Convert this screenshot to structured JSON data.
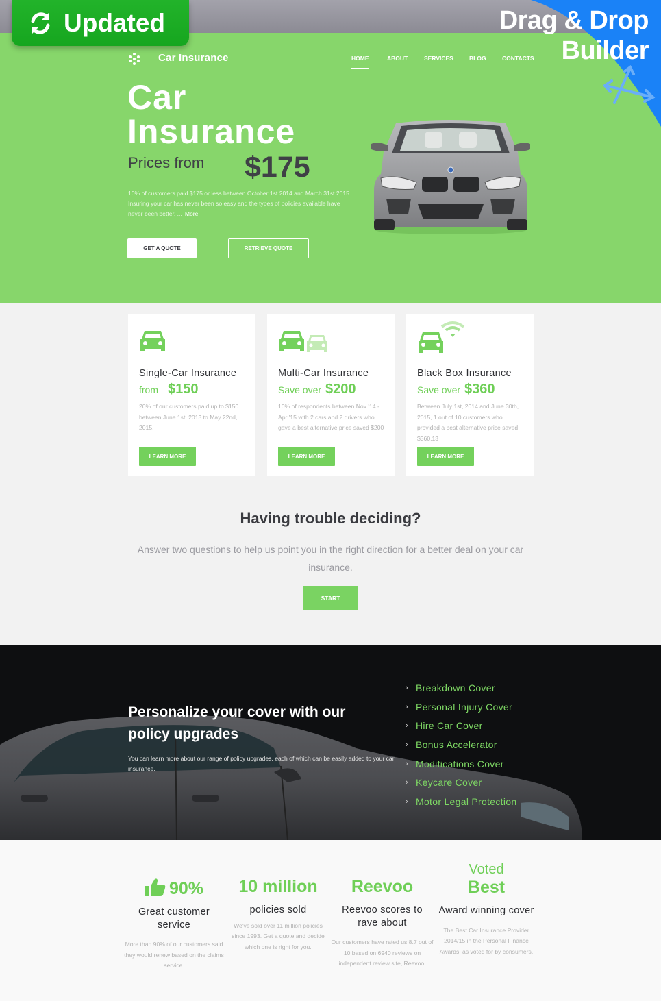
{
  "badges": {
    "updated_label": "Updated",
    "drag_drop_line1": "Drag & Drop",
    "drag_drop_line2": "Builder",
    "updated_color": "#1db025",
    "drag_drop_color": "#1a82f7"
  },
  "header": {
    "brand": "Car Insurance",
    "logo_icon": "dots-logo-icon",
    "nav": [
      {
        "label": "HOME",
        "active": true
      },
      {
        "label": "ABOUT",
        "active": false
      },
      {
        "label": "SERVICES",
        "active": false
      },
      {
        "label": "BLOG",
        "active": false
      },
      {
        "label": "CONTACTS",
        "active": false
      }
    ]
  },
  "hero": {
    "title_line1": "Car",
    "title_line2": "Insurance",
    "prices_from": "Prices from",
    "price": "$175",
    "description": "10% of customers paid $175 or less between October 1st 2014 and March 31st 2015. Insuring your car has never been so easy and the types of policies available have never been better. ...",
    "more_link": "More",
    "get_quote": "GET A QUOTE",
    "retrieve_quote": "RETRIEVE QUOTE",
    "accent_color": "#87d66b"
  },
  "cards": [
    {
      "icon": "car-icon",
      "title": "Single-Car Insurance",
      "price_prefix": "from",
      "price": "$150",
      "description": "20% of our customers paid up to $150 between June 1st, 2013 to May 22nd, 2015.",
      "button": "LEARN MORE"
    },
    {
      "icon": "two-cars-icon",
      "title": "Multi-Car Insurance",
      "price_prefix": "Save over",
      "price": "$200",
      "description": "10% of respondents between Nov '14 - Apr '15 with 2 cars and 2 drivers who gave a best alternative price saved $200",
      "button": "LEARN MORE"
    },
    {
      "icon": "car-wifi-icon",
      "title": "Black Box Insurance",
      "price_prefix": "Save over",
      "price": "$360",
      "description": "Between July 1st, 2014 and June 30th, 2015, 1 out of 10 customers who provided a best alternative price saved $360.13",
      "button": "LEARN MORE"
    }
  ],
  "trouble": {
    "title": "Having trouble deciding?",
    "description": "Answer two questions to help us point you in the right direction for a better deal on your car insurance.",
    "button": "START"
  },
  "upgrades": {
    "title": "Personalize your cover with our policy upgrades",
    "description": "You can learn more about our range of policy upgrades, each of which can be easily added to your car insurance.",
    "items": [
      "Breakdown Cover",
      "Personal Injury Cover",
      "Hire Car Cover",
      "Bonus Accelerator",
      "Modifications Cover",
      "Keycare Cover",
      "Motor Legal Protection"
    ]
  },
  "stats": [
    {
      "icon": "thumbs-up-icon",
      "value": "90%",
      "title": "Great customer service",
      "description": "More than 90% of our customers said they would renew based on the claims service."
    },
    {
      "value": "10 million",
      "title": "policies sold",
      "description": "We've sold over 11 million policies since 1993. Get a quote and decide which one is right for you."
    },
    {
      "value": "Reevoo",
      "title": "Reevoo scores to rave about",
      "description": "Our customers have rated us 8.7 out of 10 based on 6940 reviews on independent review site, Reevoo."
    },
    {
      "value_line1": "Voted",
      "value_line2": "Best",
      "title": "Award winning cover",
      "description": "The Best Car Insurance Provider 2014/15 in the Personal Finance Awards, as voted for by consumers."
    }
  ]
}
